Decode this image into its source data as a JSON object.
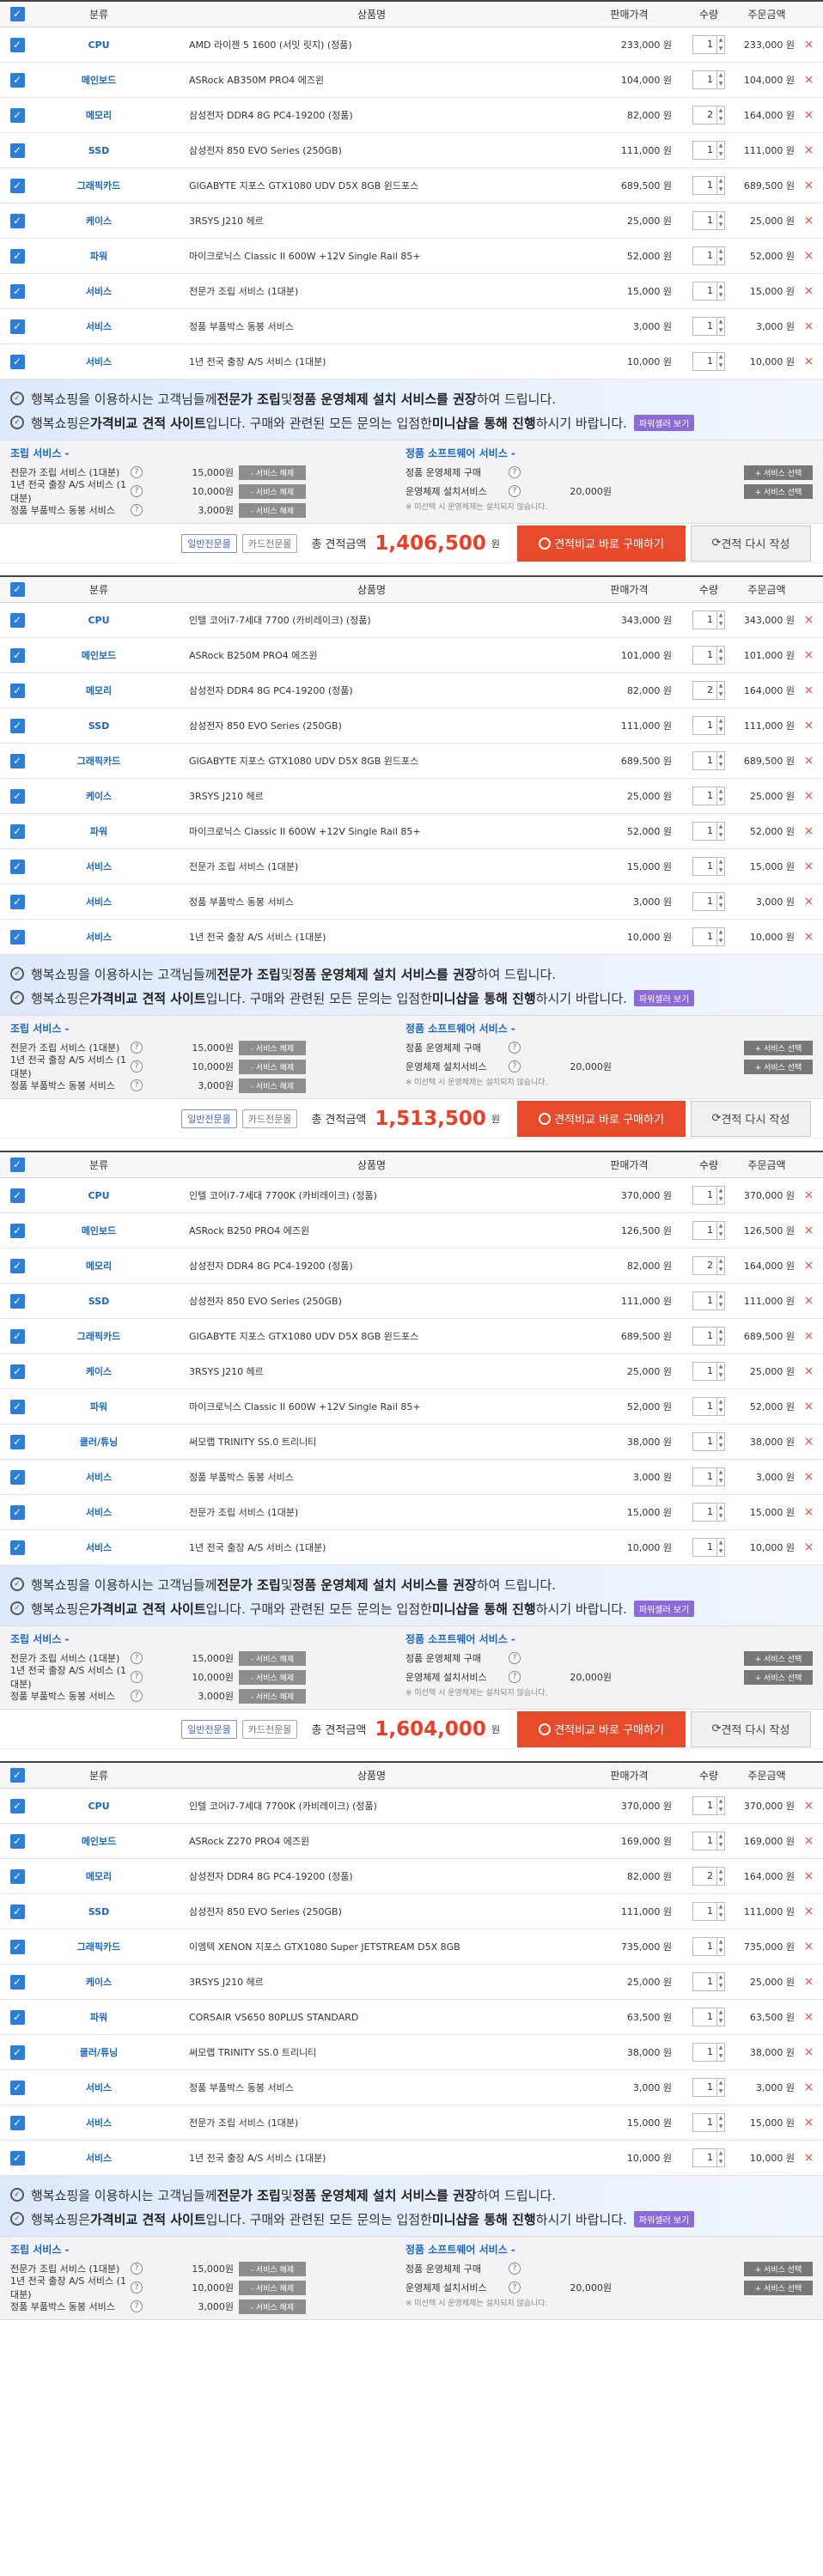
{
  "headers": {
    "cat": "분류",
    "name": "상품명",
    "price": "판매가격",
    "qty": "수량",
    "total": "주문금액"
  },
  "common": {
    "notice1_pre": "행복쇼핑을 이용하시는 고객님들께 ",
    "notice1_b1": "전문가 조립",
    "notice1_mid": " 및 ",
    "notice1_b2": "정품 운영체제 설치 서비스를 권장",
    "notice1_post": "하여 드립니다.",
    "notice2_pre": "행복쇼핑은 ",
    "notice2_b1": "가격비교 견적 사이트",
    "notice2_mid": "입니다. 구매와 관련된 모든 문의는 입점한 ",
    "notice2_b2": "미니샵을 통해 진행",
    "notice2_post": "하시기 바랍니다.",
    "shop_btn": "파워셀러 보기",
    "assembly_title": "조립 서비스 -",
    "software_title": "정품 소프트웨어 서비스 -",
    "asm": [
      {
        "name": "전문가 조립 서비스 (1대분)",
        "price": "15,000원",
        "btn": "- 서비스 해제"
      },
      {
        "name": "1년 전국 출장 A/S 서비스 (1대분)",
        "price": "10,000원",
        "btn": "- 서비스 해제"
      },
      {
        "name": "정품 부품박스 동봉 서비스",
        "price": "3,000원",
        "btn": "- 서비스 해제"
      }
    ],
    "sw": [
      {
        "name": "정품 운영체제 구매",
        "price": "",
        "btn": "+ 서비스 선택"
      },
      {
        "name": "운영체제 설치서비스",
        "price": "20,000원",
        "btn": "+ 서비스 선택"
      }
    ],
    "sw_note": "※ 미선택 시 운영체제는 설치되지 않습니다.",
    "badge1": "일반전문몰",
    "badge2": "카드전문몰",
    "total_label": "총 견적금액",
    "won": "원",
    "buy_btn": "견적비교 바로 구매하기",
    "redo_btn": "견적 다시 작성",
    "qty_up": "▲",
    "qty_down": "▼",
    "check": "✓",
    "delete": "×"
  },
  "quotes": [
    {
      "total": "1,406,500",
      "items": [
        {
          "cat": "CPU",
          "name": "AMD 라이젠 5 1600 (서밋 릿지) (정품)",
          "price": "233,000 원",
          "qty": "1",
          "total": "233,000 원"
        },
        {
          "cat": "메인보드",
          "name": "ASRock AB350M PRO4 에즈윈",
          "price": "104,000 원",
          "qty": "1",
          "total": "104,000 원"
        },
        {
          "cat": "메모리",
          "name": "삼성전자 DDR4 8G PC4-19200 (정품)",
          "price": "82,000 원",
          "qty": "2",
          "total": "164,000 원"
        },
        {
          "cat": "SSD",
          "name": "삼성전자 850 EVO Series (250GB)",
          "price": "111,000 원",
          "qty": "1",
          "total": "111,000 원"
        },
        {
          "cat": "그래픽카드",
          "name": "GIGABYTE 지포스 GTX1080 UDV D5X 8GB 윈드포스",
          "price": "689,500 원",
          "qty": "1",
          "total": "689,500 원"
        },
        {
          "cat": "케이스",
          "name": "3RSYS J210 헤르",
          "price": "25,000 원",
          "qty": "1",
          "total": "25,000 원"
        },
        {
          "cat": "파워",
          "name": "마이크로닉스 Classic II 600W +12V Single Rail 85+",
          "price": "52,000 원",
          "qty": "1",
          "total": "52,000 원"
        },
        {
          "cat": "서비스",
          "name": "전문가 조립 서비스 (1대분)",
          "price": "15,000 원",
          "qty": "1",
          "total": "15,000 원"
        },
        {
          "cat": "서비스",
          "name": "정품 부품박스 동봉 서비스",
          "price": "3,000 원",
          "qty": "1",
          "total": "3,000 원"
        },
        {
          "cat": "서비스",
          "name": "1년 전국 출장 A/S 서비스 (1대분)",
          "price": "10,000 원",
          "qty": "1",
          "total": "10,000 원"
        }
      ]
    },
    {
      "total": "1,513,500",
      "items": [
        {
          "cat": "CPU",
          "name": "인텔 코어i7-7세대 7700 (카비레이크) (정품)",
          "price": "343,000 원",
          "qty": "1",
          "total": "343,000 원"
        },
        {
          "cat": "메인보드",
          "name": "ASRock B250M PRO4 에즈윈",
          "price": "101,000 원",
          "qty": "1",
          "total": "101,000 원"
        },
        {
          "cat": "메모리",
          "name": "삼성전자 DDR4 8G PC4-19200 (정품)",
          "price": "82,000 원",
          "qty": "2",
          "total": "164,000 원"
        },
        {
          "cat": "SSD",
          "name": "삼성전자 850 EVO Series (250GB)",
          "price": "111,000 원",
          "qty": "1",
          "total": "111,000 원"
        },
        {
          "cat": "그래픽카드",
          "name": "GIGABYTE 지포스 GTX1080 UDV D5X 8GB 윈드포스",
          "price": "689,500 원",
          "qty": "1",
          "total": "689,500 원"
        },
        {
          "cat": "케이스",
          "name": "3RSYS J210 헤르",
          "price": "25,000 원",
          "qty": "1",
          "total": "25,000 원"
        },
        {
          "cat": "파워",
          "name": "마이크로닉스 Classic II 600W +12V Single Rail 85+",
          "price": "52,000 원",
          "qty": "1",
          "total": "52,000 원"
        },
        {
          "cat": "서비스",
          "name": "전문가 조립 서비스 (1대분)",
          "price": "15,000 원",
          "qty": "1",
          "total": "15,000 원"
        },
        {
          "cat": "서비스",
          "name": "정품 부품박스 동봉 서비스",
          "price": "3,000 원",
          "qty": "1",
          "total": "3,000 원"
        },
        {
          "cat": "서비스",
          "name": "1년 전국 출장 A/S 서비스 (1대분)",
          "price": "10,000 원",
          "qty": "1",
          "total": "10,000 원"
        }
      ]
    },
    {
      "total": "1,604,000",
      "items": [
        {
          "cat": "CPU",
          "name": "인텔 코어i7-7세대 7700K (카비레이크) (정품)",
          "price": "370,000 원",
          "qty": "1",
          "total": "370,000 원"
        },
        {
          "cat": "메인보드",
          "name": "ASRock B250 PRO4 에즈윈",
          "price": "126,500 원",
          "qty": "1",
          "total": "126,500 원"
        },
        {
          "cat": "메모리",
          "name": "삼성전자 DDR4 8G PC4-19200 (정품)",
          "price": "82,000 원",
          "qty": "2",
          "total": "164,000 원"
        },
        {
          "cat": "SSD",
          "name": "삼성전자 850 EVO Series (250GB)",
          "price": "111,000 원",
          "qty": "1",
          "total": "111,000 원"
        },
        {
          "cat": "그래픽카드",
          "name": "GIGABYTE 지포스 GTX1080 UDV D5X 8GB 윈드포스",
          "price": "689,500 원",
          "qty": "1",
          "total": "689,500 원"
        },
        {
          "cat": "케이스",
          "name": "3RSYS J210 헤르",
          "price": "25,000 원",
          "qty": "1",
          "total": "25,000 원"
        },
        {
          "cat": "파워",
          "name": "마이크로닉스 Classic II 600W +12V Single Rail 85+",
          "price": "52,000 원",
          "qty": "1",
          "total": "52,000 원"
        },
        {
          "cat": "쿨러/튜닝",
          "name": "써모랩 TRINITY SS.0 트리니티",
          "price": "38,000 원",
          "qty": "1",
          "total": "38,000 원"
        },
        {
          "cat": "서비스",
          "name": "정품 부품박스 동봉 서비스",
          "price": "3,000 원",
          "qty": "1",
          "total": "3,000 원"
        },
        {
          "cat": "서비스",
          "name": "전문가 조립 서비스 (1대분)",
          "price": "15,000 원",
          "qty": "1",
          "total": "15,000 원"
        },
        {
          "cat": "서비스",
          "name": "1년 전국 출장 A/S 서비스 (1대분)",
          "price": "10,000 원",
          "qty": "1",
          "total": "10,000 원"
        }
      ]
    },
    {
      "total": "",
      "items": [
        {
          "cat": "CPU",
          "name": "인텔 코어i7-7세대 7700K (카비레이크) (정품)",
          "price": "370,000 원",
          "qty": "1",
          "total": "370,000 원"
        },
        {
          "cat": "메인보드",
          "name": "ASRock Z270 PRO4 에즈윈",
          "price": "169,000 원",
          "qty": "1",
          "total": "169,000 원"
        },
        {
          "cat": "메모리",
          "name": "삼성전자 DDR4 8G PC4-19200 (정품)",
          "price": "82,000 원",
          "qty": "2",
          "total": "164,000 원"
        },
        {
          "cat": "SSD",
          "name": "삼성전자 850 EVO Series (250GB)",
          "price": "111,000 원",
          "qty": "1",
          "total": "111,000 원"
        },
        {
          "cat": "그래픽카드",
          "name": "이엠텍 XENON 지포스 GTX1080 Super JETSTREAM D5X 8GB",
          "price": "735,000 원",
          "qty": "1",
          "total": "735,000 원"
        },
        {
          "cat": "케이스",
          "name": "3RSYS J210 헤르",
          "price": "25,000 원",
          "qty": "1",
          "total": "25,000 원"
        },
        {
          "cat": "파워",
          "name": "CORSAIR VS650 80PLUS STANDARD",
          "price": "63,500 원",
          "qty": "1",
          "total": "63,500 원"
        },
        {
          "cat": "쿨러/튜닝",
          "name": "써모랩 TRINITY SS.0 트리니티",
          "price": "38,000 원",
          "qty": "1",
          "total": "38,000 원"
        },
        {
          "cat": "서비스",
          "name": "정품 부품박스 동봉 서비스",
          "price": "3,000 원",
          "qty": "1",
          "total": "3,000 원"
        },
        {
          "cat": "서비스",
          "name": "전문가 조립 서비스 (1대분)",
          "price": "15,000 원",
          "qty": "1",
          "total": "15,000 원"
        },
        {
          "cat": "서비스",
          "name": "1년 전국 출장 A/S 서비스 (1대분)",
          "price": "10,000 원",
          "qty": "1",
          "total": "10,000 원"
        }
      ]
    }
  ]
}
